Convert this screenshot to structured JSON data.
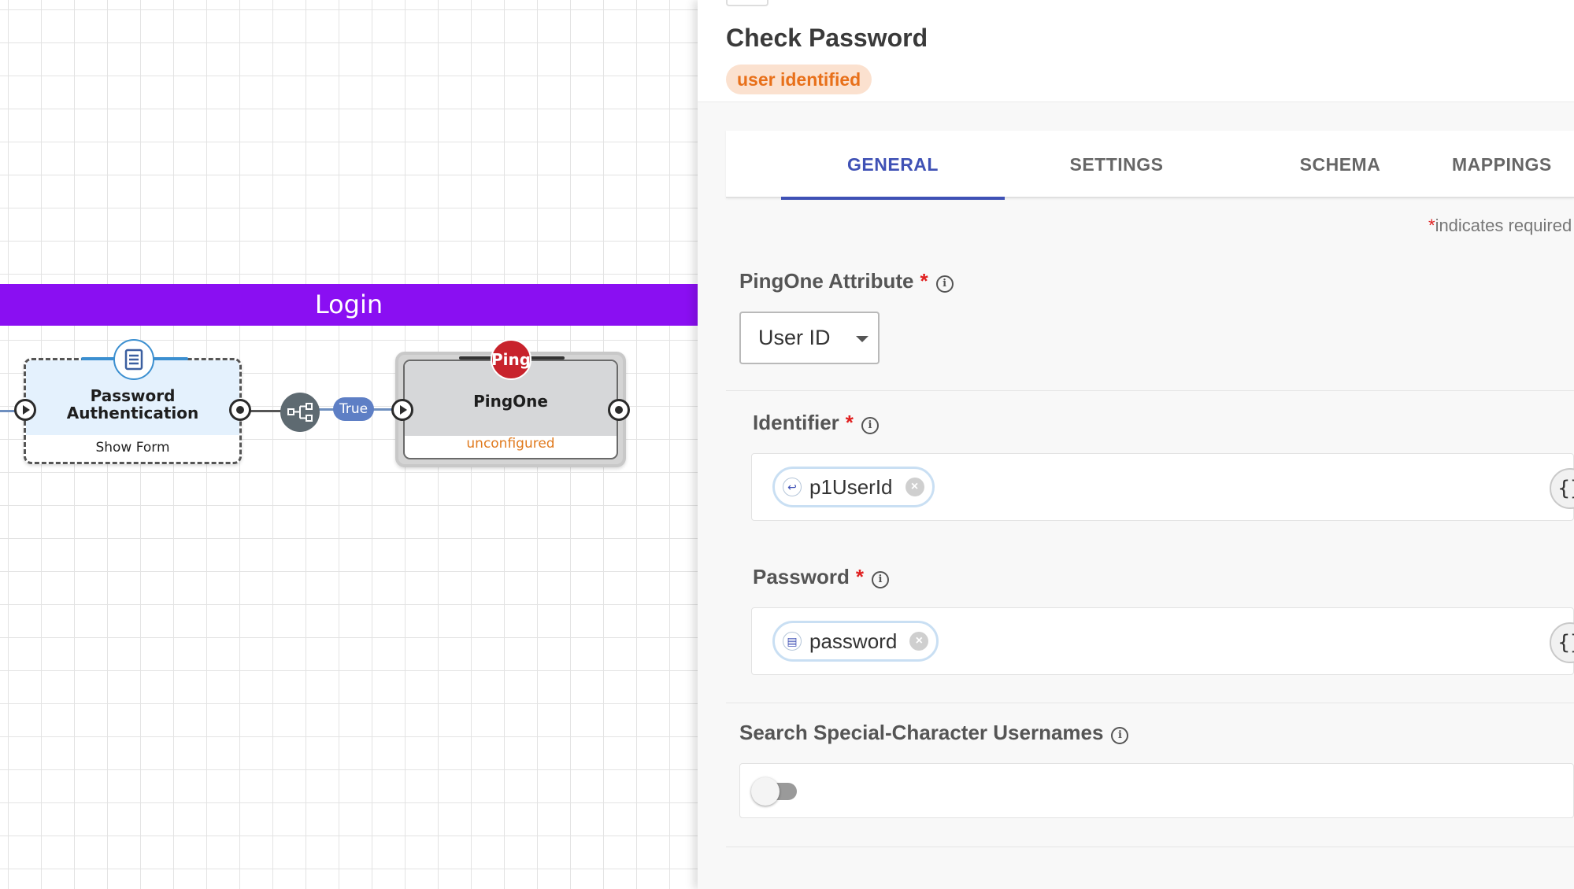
{
  "canvas": {
    "lane_title": "Login",
    "nodes": [
      {
        "title_line1": "Password",
        "title_line2": "Authentication",
        "footer": "Show Form"
      },
      {
        "title": "PingOne",
        "badge": "Ping",
        "footer": "unconfigured"
      }
    ],
    "edge_label": "True"
  },
  "panel": {
    "title": "Check Password",
    "status_badge": "user identified",
    "tabs": [
      "GENERAL",
      "SETTINGS",
      "SCHEMA",
      "MAPPINGS"
    ],
    "active_tab": "GENERAL",
    "required_note": "indicates required",
    "required_star": "*",
    "fields": {
      "pingone_attribute": {
        "label": "PingOne Attribute",
        "value": "User ID"
      },
      "identifier": {
        "label": "Identifier",
        "chip": "p1UserId"
      },
      "password": {
        "label": "Password",
        "chip": "password"
      },
      "search_special": {
        "label": "Search Special-Character Usernames",
        "enabled": false
      }
    },
    "expr_button": "{}",
    "info_glyph": "i"
  },
  "colors": {
    "lane": "#8a0ff2",
    "accent": "#3f51b5",
    "badge_bg": "#fbe1cf",
    "badge_text": "#e8701a",
    "ping_red": "#c8232c",
    "required": "#e02020"
  }
}
